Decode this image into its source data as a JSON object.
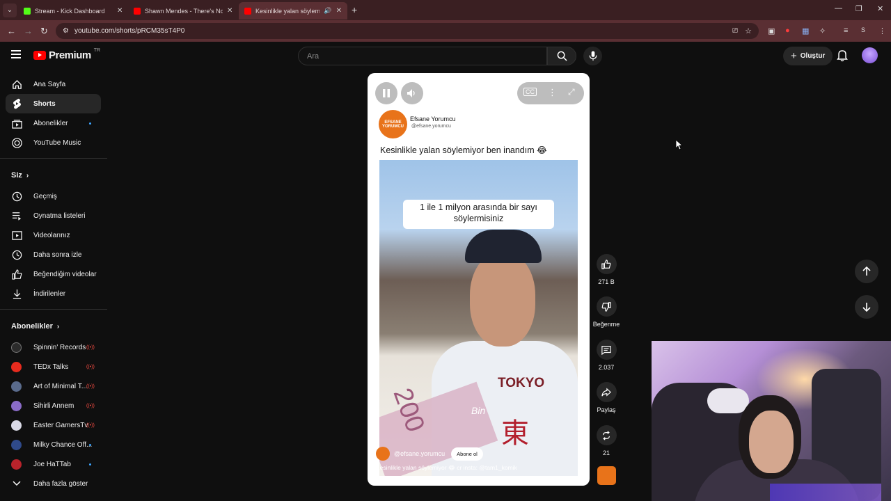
{
  "browser": {
    "tabs": [
      {
        "title": "Stream - Kick Dashboard",
        "favicon_color": "#53fc18"
      },
      {
        "title": "Shawn Mendes - There's Nothi",
        "favicon_color": "#ff0000"
      },
      {
        "title": "Kesinlikle yalan söylemiyor (",
        "favicon_color": "#ff0000"
      }
    ],
    "url": "youtube.com/shorts/pRCM35sT4P0",
    "profile_letter": "S"
  },
  "header": {
    "logo_text": "Premium",
    "logo_region": "TR",
    "search_placeholder": "Ara",
    "create_label": "Oluştur"
  },
  "sidebar": {
    "main_items": [
      {
        "label": "Ana Sayfa",
        "icon": "home-icon"
      },
      {
        "label": "Shorts",
        "icon": "shorts-icon"
      },
      {
        "label": "Abonelikler",
        "icon": "subscriptions-icon"
      },
      {
        "label": "YouTube Music",
        "icon": "music-icon"
      }
    ],
    "you_heading": "Siz",
    "you_items": [
      {
        "label": "Geçmiş",
        "icon": "history-icon"
      },
      {
        "label": "Oynatma listeleri",
        "icon": "playlist-icon"
      },
      {
        "label": "Videolarınız",
        "icon": "your-videos-icon"
      },
      {
        "label": "Daha sonra izle",
        "icon": "watch-later-icon"
      },
      {
        "label": "Beğendiğim videolar",
        "icon": "liked-icon"
      },
      {
        "label": "İndirilenler",
        "icon": "download-icon"
      }
    ],
    "subs_heading": "Abonelikler",
    "subscriptions": [
      {
        "label": "Spinnin' Records",
        "color": "#2b2b2b",
        "status": "live"
      },
      {
        "label": "TEDx Talks",
        "color": "#e62b1e",
        "status": "live"
      },
      {
        "label": "Art of Minimal T...",
        "color": "#5a6b8c",
        "status": "live"
      },
      {
        "label": "Sihirli Annem",
        "color": "#8a6cc7",
        "status": "live"
      },
      {
        "label": "Easter GamersTv",
        "color": "#d9d9e6",
        "status": "live"
      },
      {
        "label": "Milky Chance Off...",
        "color": "#2f4a8a",
        "status": "new"
      },
      {
        "label": "Joe HaTTab",
        "color": "#b8232b",
        "status": "new"
      }
    ],
    "show_more_label": "Daha fazla göster"
  },
  "short": {
    "channel_name": "Efsane Yorumcu",
    "channel_handle": "@efsane.yorumcu",
    "avatar_text": "EFSANE YORUMCU",
    "post_text": "Kesinlikle yalan söylemiyor ben inandım 😂",
    "overlay_caption": "1 ile 1 milyon arasında bir sayı söylermisiniz",
    "subtitle_word": "Bin",
    "bill_text": "200",
    "shirt_text": "TOKYO",
    "kanji": "東",
    "video_handle": "@efsane.yorumcu",
    "subscribe_label": "Abone ol",
    "video_description": "Kesinlikle yalan söylemiyor 😂 cr insta: @tam1_komik"
  },
  "actions": {
    "likes": "271 B",
    "dislike_label": "Beğenme",
    "comments": "2.037",
    "share_label": "Paylaş",
    "remix_count": "21"
  }
}
